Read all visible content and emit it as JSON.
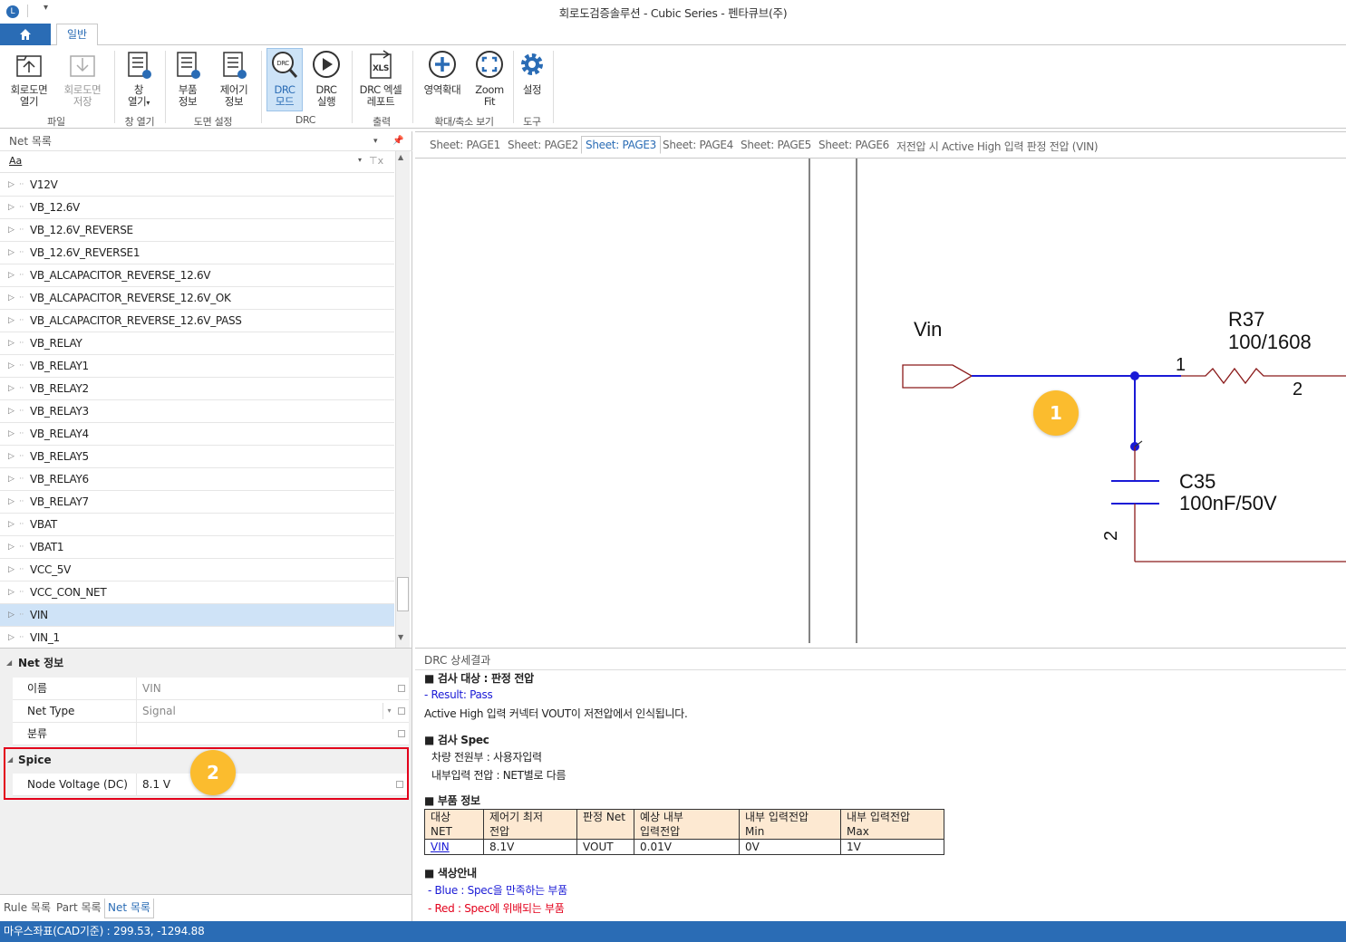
{
  "window": {
    "title": "회로도검증솔루션 - Cubic Series - 펜타큐브(주)"
  },
  "ribbon": {
    "tab_general": "일반",
    "buttons": {
      "open_schematic": "회로도면\n열기",
      "save_schematic": "회로도면\n저장",
      "open_window": "창\n열기",
      "part_info": "부품\n정보",
      "controller_info": "제어기\n정보",
      "drc_mode": "DRC\n모드",
      "drc_run": "DRC\n실행",
      "drc_excel_report": "DRC 엑셀\n레포트",
      "zoom_area": "영역확대",
      "zoom_fit": "Zoom\nFit",
      "settings": "설정"
    },
    "groups": {
      "file": "파일",
      "window_open": "창 열기",
      "drawing_settings": "도면 설정",
      "drc": "DRC",
      "output": "출력",
      "zoom": "확대/축소 보기",
      "tools": "도구"
    }
  },
  "net_list": {
    "header": "Net 목록",
    "filter_label": "Aa",
    "items": [
      "V12V",
      "VB_12.6V",
      "VB_12.6V_REVERSE",
      "VB_12.6V_REVERSE1",
      "VB_ALCAPACITOR_REVERSE_12.6V",
      "VB_ALCAPACITOR_REVERSE_12.6V_OK",
      "VB_ALCAPACITOR_REVERSE_12.6V_PASS",
      "VB_RELAY",
      "VB_RELAY1",
      "VB_RELAY2",
      "VB_RELAY3",
      "VB_RELAY4",
      "VB_RELAY5",
      "VB_RELAY6",
      "VB_RELAY7",
      "VBAT",
      "VBAT1",
      "VCC_5V",
      "VCC_CON_NET",
      "VIN",
      "VIN_1"
    ],
    "selected": "VIN"
  },
  "net_info": {
    "category": "Net 정보",
    "rows": [
      {
        "key": "이름",
        "value": "VIN"
      },
      {
        "key": "Net Type",
        "value": "Signal"
      },
      {
        "key": "분류",
        "value": ""
      }
    ],
    "spice_category": "Spice",
    "spice_rows": [
      {
        "key": "Node Voltage (DC)",
        "value": "8.1 V"
      }
    ]
  },
  "bottom_tabs": [
    "Rule 목록",
    "Part 목록",
    "Net 목록"
  ],
  "sheet_tabs": [
    "Sheet: PAGE1",
    "Sheet: PAGE2",
    "Sheet: PAGE3",
    "Sheet: PAGE4",
    "Sheet: PAGE5",
    "Sheet: PAGE6",
    "저전압 시 Active High 입력 판정 전압 (VIN)"
  ],
  "active_sheet": "Sheet: PAGE3",
  "schematic": {
    "port_label": "Vin",
    "resistor_ref": "R37",
    "resistor_value": "100/1608",
    "capacitor_ref": "C35",
    "capacitor_value": "100nF/50V",
    "pin1": "1",
    "pin2": "2",
    "cap_pin2": "2",
    "net_color": "#1a1ad6",
    "wire_color": "#8b1a1a"
  },
  "badges": {
    "one": "1",
    "two": "2"
  },
  "drc": {
    "header": "DRC 상세결과",
    "target_title": "■ 검사 대상 : 판정 전압",
    "result": "- Result: Pass",
    "description": "Active High 입력 커넥터 VOUT이 저전압에서 인식됩니다.",
    "spec_title": "■ 검사 Spec",
    "spec_line1": "차량 전원부 : 사용자입력",
    "spec_line2": "내부입력 전압 : NET별로 다름",
    "parts_title": "■ 부품 정보",
    "table_headers": [
      "대상\nNET",
      "제어기 최저\n전압",
      "판정 Net",
      "예상 내부\n입력전압",
      "내부 입력전압\nMin",
      "내부 입력전압\nMax"
    ],
    "table_row": [
      "VIN",
      "8.1V",
      "VOUT",
      "0.01V",
      "0V",
      "1V"
    ],
    "color_title": "■ 색상안내",
    "blue_note": "- Blue : Spec을 만족하는 부품",
    "red_note": "- Red : Spec에 위배되는 부품"
  },
  "status": {
    "mouse_coords": "마우스좌표(CAD기준) : 299.53, -1294.88"
  },
  "colors": {
    "accent": "#2a6cb5",
    "highlight_red": "#e3001b",
    "badge": "#fbbc2e",
    "pass_blue": "#1a1ad6",
    "fail_red": "#e3001b"
  }
}
